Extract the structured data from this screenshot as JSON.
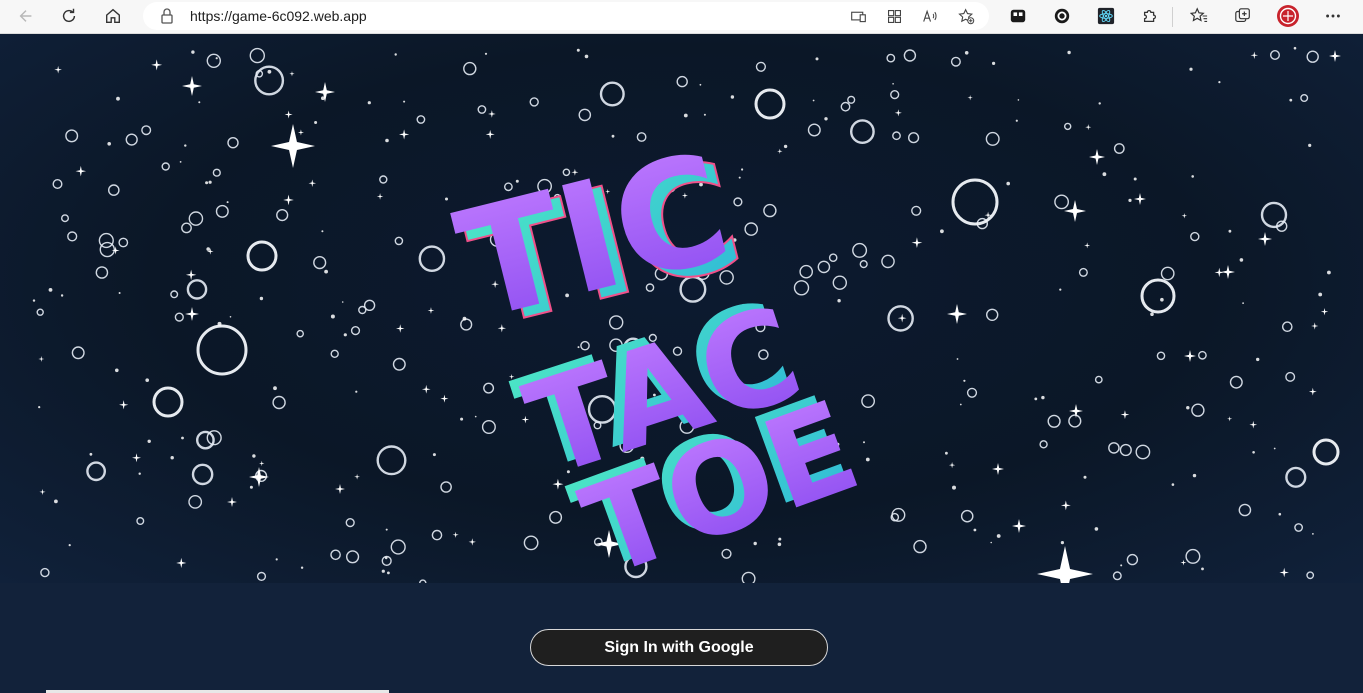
{
  "browser": {
    "url": "https://game-6c092.web.app",
    "toolbar_icons": [
      "back-icon",
      "refresh-icon",
      "home-icon"
    ],
    "address_icons": [
      "device-icon",
      "apps-icon",
      "read-aloud-icon",
      "favorite-add-icon"
    ],
    "extension_icons": [
      "extension-a-icon",
      "extension-b-icon",
      "react-devtools-icon",
      "puzzle-extensions-icon",
      "favorites-icon",
      "collections-icon",
      "profile-icon",
      "more-icon"
    ]
  },
  "game": {
    "title_lines": [
      "TIC",
      "TAC",
      "TOE"
    ],
    "title_colors": {
      "primary": "#a35bf5",
      "secondary": "#48e6c1",
      "accent": "#f0508a"
    }
  },
  "auth": {
    "signin_label": "Sign In with Google"
  },
  "colors": {
    "background": "#12223a",
    "button_bg": "#1f1f1f",
    "button_border": "#d7d7d7"
  }
}
